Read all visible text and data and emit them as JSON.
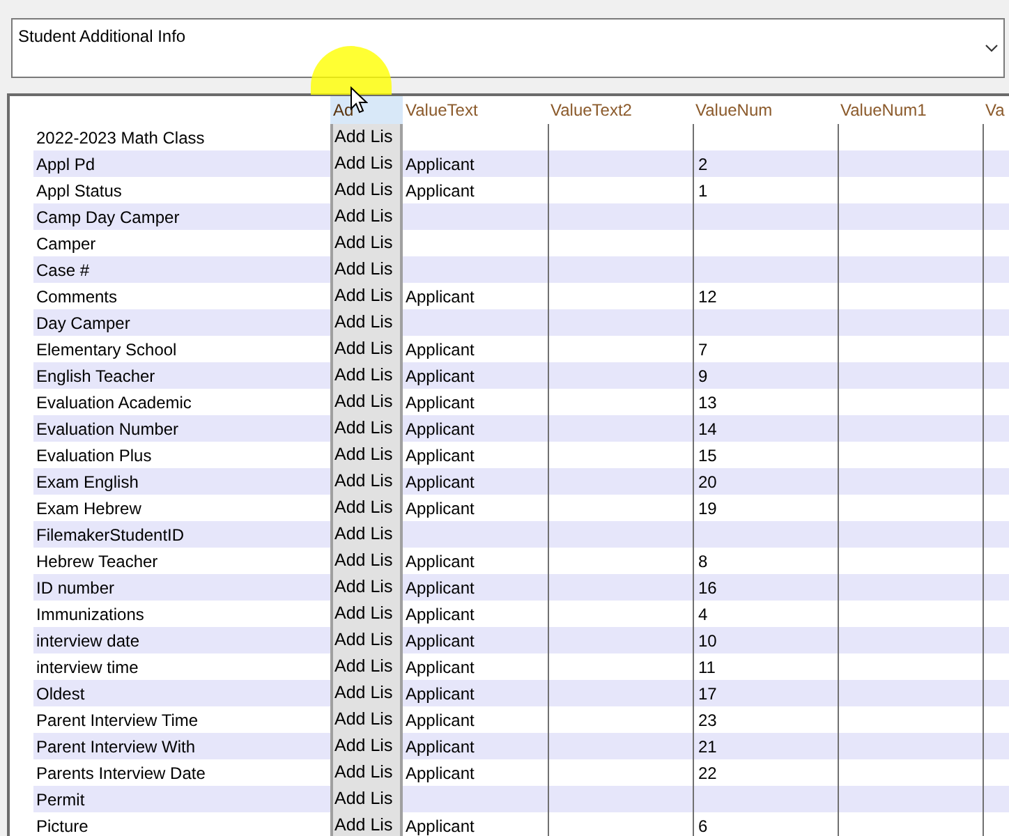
{
  "dropdown": {
    "value": "Student Additional Info"
  },
  "columns": [
    "Ad",
    "ValueText",
    "ValueText2",
    "ValueNum",
    "ValueNum1",
    "Va"
  ],
  "rows": [
    {
      "name": "2022-2023 Math Class",
      "button": "Add Lis",
      "value_text": "",
      "value_num": ""
    },
    {
      "name": "Appl Pd",
      "button": "Add Lis",
      "value_text": "Applicant",
      "value_num": "2"
    },
    {
      "name": "Appl Status",
      "button": "Add Lis",
      "value_text": "Applicant",
      "value_num": "1"
    },
    {
      "name": "Camp Day Camper",
      "button": "Add Lis",
      "value_text": "",
      "value_num": ""
    },
    {
      "name": "Camper",
      "button": "Add Lis",
      "value_text": "",
      "value_num": ""
    },
    {
      "name": "Case #",
      "button": "Add Lis",
      "value_text": "",
      "value_num": ""
    },
    {
      "name": "Comments",
      "button": "Add Lis",
      "value_text": "Applicant",
      "value_num": "12"
    },
    {
      "name": "Day Camper",
      "button": "Add Lis",
      "value_text": "",
      "value_num": ""
    },
    {
      "name": "Elementary School",
      "button": "Add Lis",
      "value_text": "Applicant",
      "value_num": "7"
    },
    {
      "name": "English Teacher",
      "button": "Add Lis",
      "value_text": "Applicant",
      "value_num": "9"
    },
    {
      "name": "Evaluation Academic",
      "button": "Add Lis",
      "value_text": "Applicant",
      "value_num": "13"
    },
    {
      "name": "Evaluation Number",
      "button": "Add Lis",
      "value_text": "Applicant",
      "value_num": "14"
    },
    {
      "name": "Evaluation Plus",
      "button": "Add Lis",
      "value_text": "Applicant",
      "value_num": "15"
    },
    {
      "name": "Exam English",
      "button": "Add Lis",
      "value_text": "Applicant",
      "value_num": "20"
    },
    {
      "name": "Exam Hebrew",
      "button": "Add Lis",
      "value_text": "Applicant",
      "value_num": "19"
    },
    {
      "name": "FilemakerStudentID",
      "button": "Add Lis",
      "value_text": "",
      "value_num": ""
    },
    {
      "name": "Hebrew Teacher",
      "button": "Add Lis",
      "value_text": "Applicant",
      "value_num": "8"
    },
    {
      "name": "ID number",
      "button": "Add Lis",
      "value_text": "Applicant",
      "value_num": "16"
    },
    {
      "name": "Immunizations",
      "button": "Add Lis",
      "value_text": "Applicant",
      "value_num": "4"
    },
    {
      "name": "interview date",
      "button": "Add Lis",
      "value_text": "Applicant",
      "value_num": "10"
    },
    {
      "name": "interview time",
      "button": "Add Lis",
      "value_text": "Applicant",
      "value_num": "11"
    },
    {
      "name": "Oldest",
      "button": "Add Lis",
      "value_text": "Applicant",
      "value_num": "17"
    },
    {
      "name": "Parent Interview Time",
      "button": "Add Lis",
      "value_text": "Applicant",
      "value_num": "23"
    },
    {
      "name": "Parent Interview With",
      "button": "Add Lis",
      "value_text": "Applicant",
      "value_num": "21"
    },
    {
      "name": "Parents Interview Date",
      "button": "Add Lis",
      "value_text": "Applicant",
      "value_num": "22"
    },
    {
      "name": "Permit",
      "button": "Add Lis",
      "value_text": "",
      "value_num": ""
    },
    {
      "name": "Picture",
      "button": "Add Lis",
      "value_text": "Applicant",
      "value_num": "6"
    }
  ]
}
